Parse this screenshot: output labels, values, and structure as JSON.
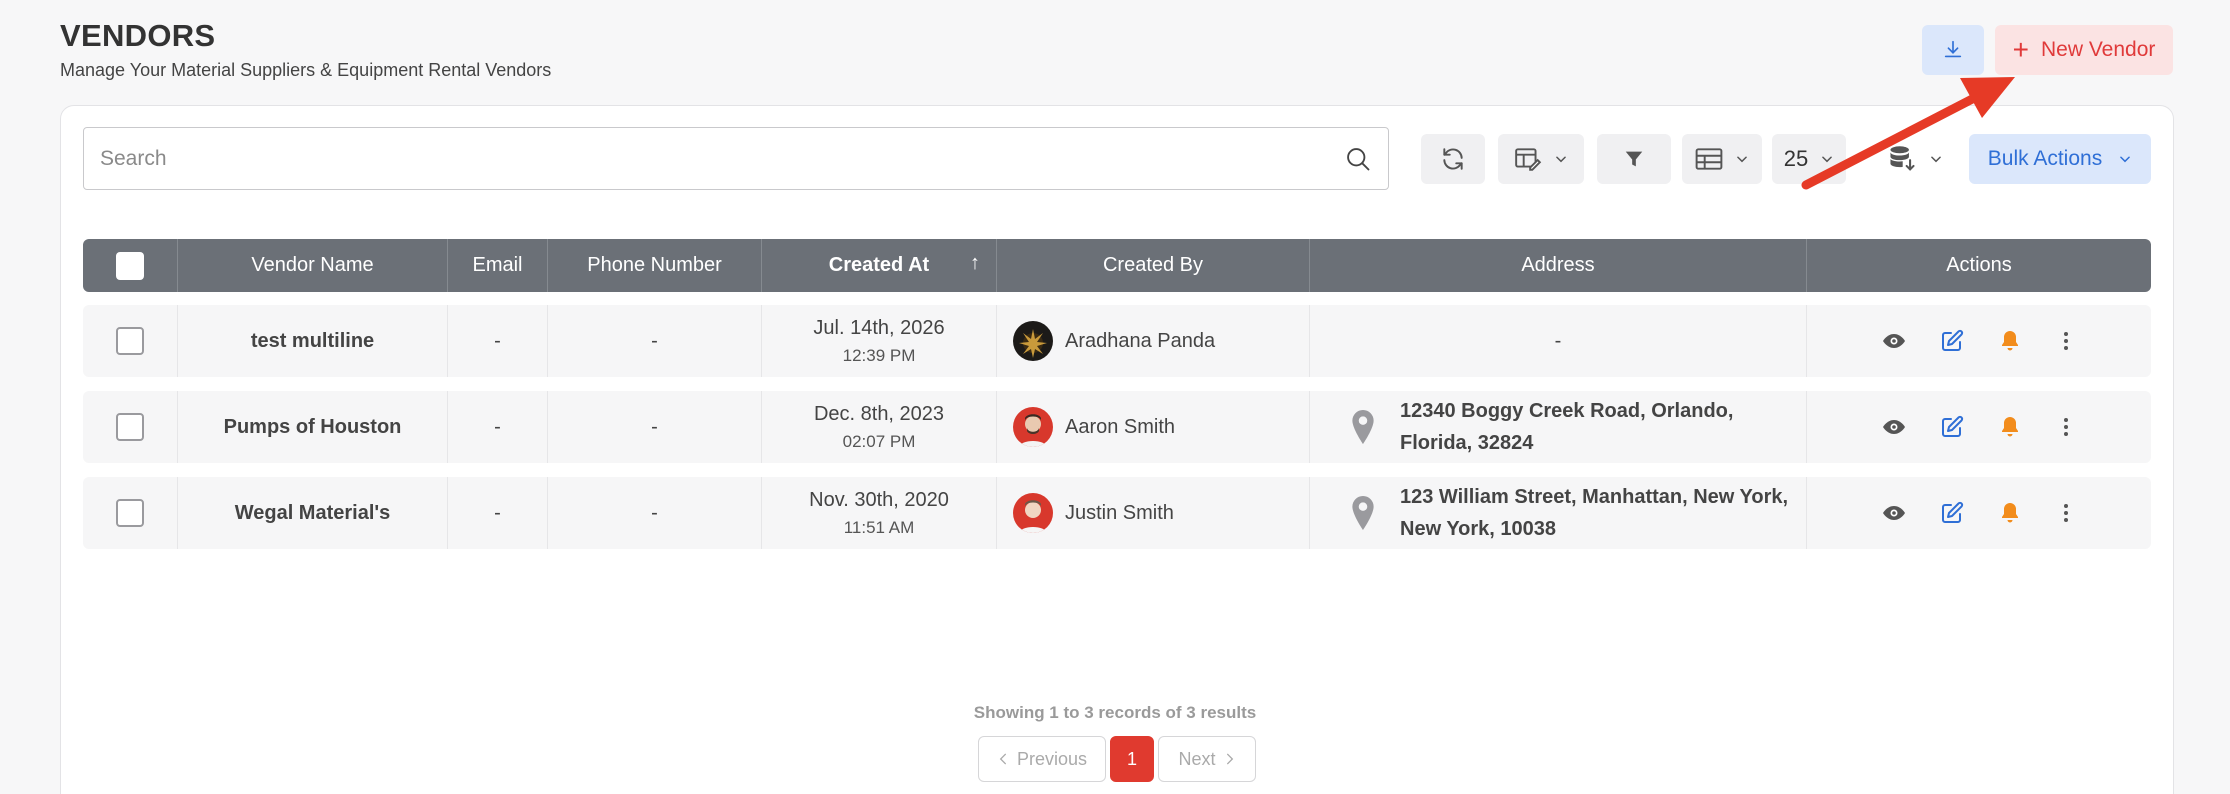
{
  "header": {
    "title": "VENDORS",
    "subtitle": "Manage Your Material Suppliers & Equipment Rental Vendors",
    "new_vendor_label": "New Vendor",
    "new_vendor_icon": "plus-icon",
    "download_icon": "download-icon"
  },
  "toolbar": {
    "search_placeholder": "Search",
    "page_size": "25",
    "bulk_actions_label": "Bulk Actions",
    "icons": [
      "refresh-icon",
      "column-edit-icon",
      "filter-icon",
      "table-layout-icon",
      "database-export-icon"
    ]
  },
  "table": {
    "columns": [
      "Vendor Name",
      "Email",
      "Phone Number",
      "Created At",
      "Created By",
      "Address",
      "Actions"
    ],
    "sorted_column": "Created At",
    "sort_direction": "asc",
    "rows": [
      {
        "vendor_name": "test multiline",
        "email": "-",
        "phone": "-",
        "created_date": "Jul. 14th, 2026",
        "created_time": "12:39 PM",
        "created_by": "Aradhana Panda",
        "address": "-"
      },
      {
        "vendor_name": "Pumps of Houston",
        "email": "-",
        "phone": "-",
        "created_date": "Dec. 8th, 2023",
        "created_time": "02:07 PM",
        "created_by": "Aaron Smith",
        "address": "12340 Boggy Creek Road, Orlando, Florida, 32824"
      },
      {
        "vendor_name": "Wegal Material's",
        "email": "-",
        "phone": "-",
        "created_date": "Nov. 30th, 2020",
        "created_time": "11:51 AM",
        "created_by": "Justin Smith",
        "address": "123 William Street, Manhattan, New York, New York, 10038"
      }
    ]
  },
  "pagination": {
    "summary": "Showing 1 to 3 records of 3 results",
    "previous": "Previous",
    "next": "Next",
    "current_page": "1"
  },
  "colors": {
    "accent_blue": "#2f6fd6",
    "accent_red": "#e03a3a",
    "bell_orange": "#f28c1c",
    "header_gray": "#6b7077"
  }
}
